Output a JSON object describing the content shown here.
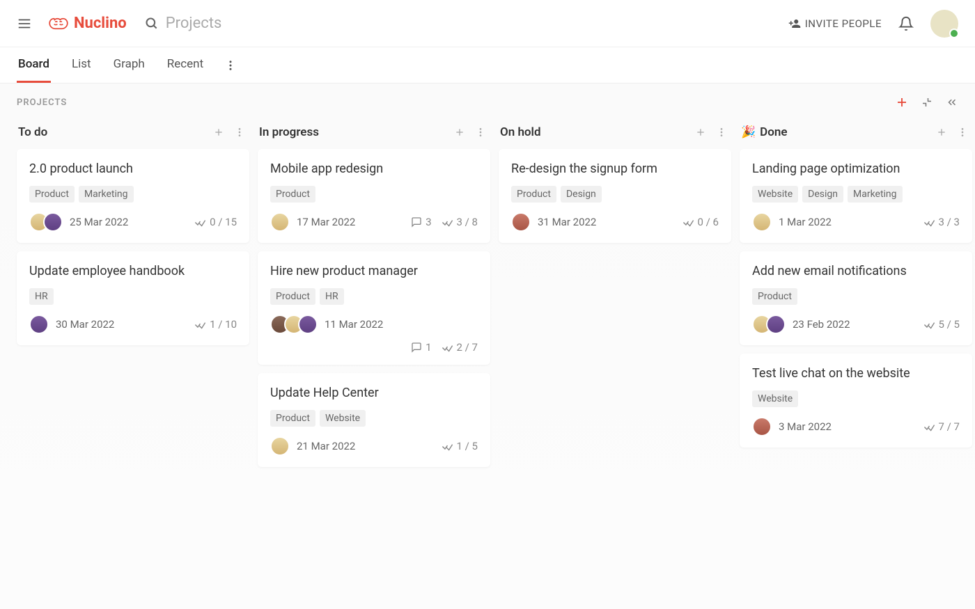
{
  "header": {
    "logo_text": "Nuclino",
    "search_placeholder": "Projects",
    "invite_label": "INVITE PEOPLE"
  },
  "tabs": {
    "items": [
      "Board",
      "List",
      "Graph",
      "Recent"
    ],
    "active": "Board"
  },
  "board": {
    "title": "PROJECTS"
  },
  "columns": [
    {
      "title": "To do",
      "emoji": "",
      "cards": [
        {
          "title": "2.0 product launch",
          "tags": [
            "Product",
            "Marketing"
          ],
          "avatars": [
            "c1",
            "c2"
          ],
          "date": "25 Mar 2022",
          "comments": null,
          "checklist": "0 / 15",
          "two_rows": false
        },
        {
          "title": "Update employee handbook",
          "tags": [
            "HR"
          ],
          "avatars": [
            "c2"
          ],
          "date": "30 Mar 2022",
          "comments": null,
          "checklist": "1 / 10",
          "two_rows": false
        }
      ]
    },
    {
      "title": "In progress",
      "emoji": "",
      "cards": [
        {
          "title": "Mobile app redesign",
          "tags": [
            "Product"
          ],
          "avatars": [
            "c1"
          ],
          "date": "17 Mar 2022",
          "comments": "3",
          "checklist": "3 / 8",
          "two_rows": false
        },
        {
          "title": "Hire new product manager",
          "tags": [
            "Product",
            "HR"
          ],
          "avatars": [
            "c4",
            "c1",
            "c2"
          ],
          "date": "11 Mar 2022",
          "comments": "1",
          "checklist": "2 / 7",
          "two_rows": true
        },
        {
          "title": "Update Help Center",
          "tags": [
            "Product",
            "Website"
          ],
          "avatars": [
            "c1"
          ],
          "date": "21 Mar 2022",
          "comments": null,
          "checklist": "1 / 5",
          "two_rows": false
        }
      ]
    },
    {
      "title": "On hold",
      "emoji": "",
      "cards": [
        {
          "title": "Re-design the signup form",
          "tags": [
            "Product",
            "Design"
          ],
          "avatars": [
            "c3"
          ],
          "date": "31 Mar 2022",
          "comments": null,
          "checklist": "0 / 6",
          "two_rows": false
        }
      ]
    },
    {
      "title": "Done",
      "emoji": "🎉",
      "cards": [
        {
          "title": "Landing page optimization",
          "tags": [
            "Website",
            "Design",
            "Marketing"
          ],
          "avatars": [
            "c1"
          ],
          "date": "1 Mar 2022",
          "comments": null,
          "checklist": "3 / 3",
          "two_rows": false
        },
        {
          "title": "Add new email notifications",
          "tags": [
            "Product"
          ],
          "avatars": [
            "c1",
            "c2"
          ],
          "date": "23 Feb 2022",
          "comments": null,
          "checklist": "5 / 5",
          "two_rows": false
        },
        {
          "title": "Test live chat on the website",
          "tags": [
            "Website"
          ],
          "avatars": [
            "c3"
          ],
          "date": "3 Mar 2022",
          "comments": null,
          "checklist": "7 / 7",
          "two_rows": false
        }
      ]
    }
  ]
}
